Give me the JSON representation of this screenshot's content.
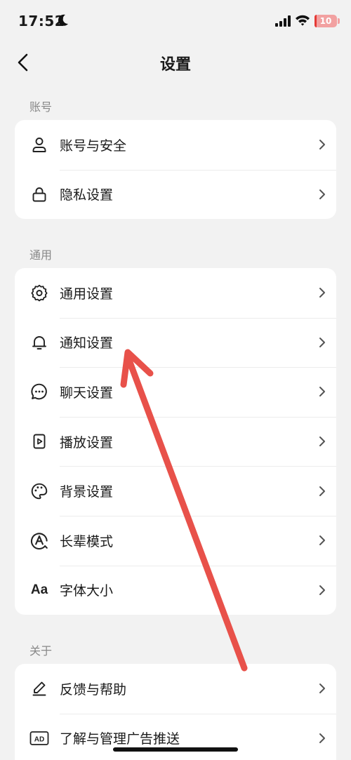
{
  "status_bar": {
    "time": "17:52",
    "battery_level": "10",
    "battery_color": "#e53935"
  },
  "nav": {
    "title": "设置",
    "back_icon": "chevron-left-icon"
  },
  "sections": [
    {
      "label": "账号",
      "items": [
        {
          "label": "账号与安全",
          "icon": "user-icon"
        },
        {
          "label": "隐私设置",
          "icon": "lock-icon"
        }
      ]
    },
    {
      "label": "通用",
      "items": [
        {
          "label": "通用设置",
          "icon": "gear-icon"
        },
        {
          "label": "通知设置",
          "icon": "bell-icon"
        },
        {
          "label": "聊天设置",
          "icon": "chat-bubble-icon"
        },
        {
          "label": "播放设置",
          "icon": "play-icon"
        },
        {
          "label": "背景设置",
          "icon": "palette-icon"
        },
        {
          "label": "长辈模式",
          "icon": "elder-mode-icon"
        },
        {
          "label": "字体大小",
          "icon": "font-size-icon",
          "icon_text": "Aa"
        }
      ]
    },
    {
      "label": "关于",
      "items": [
        {
          "label": "反馈与帮助",
          "icon": "edit-icon"
        },
        {
          "label": "了解与管理广告推送",
          "icon": "ad-icon",
          "icon_text": "AD"
        }
      ]
    }
  ],
  "annotation": {
    "arrow_color": "#e8514a",
    "arrow_icon": "annotation-arrow-icon"
  }
}
